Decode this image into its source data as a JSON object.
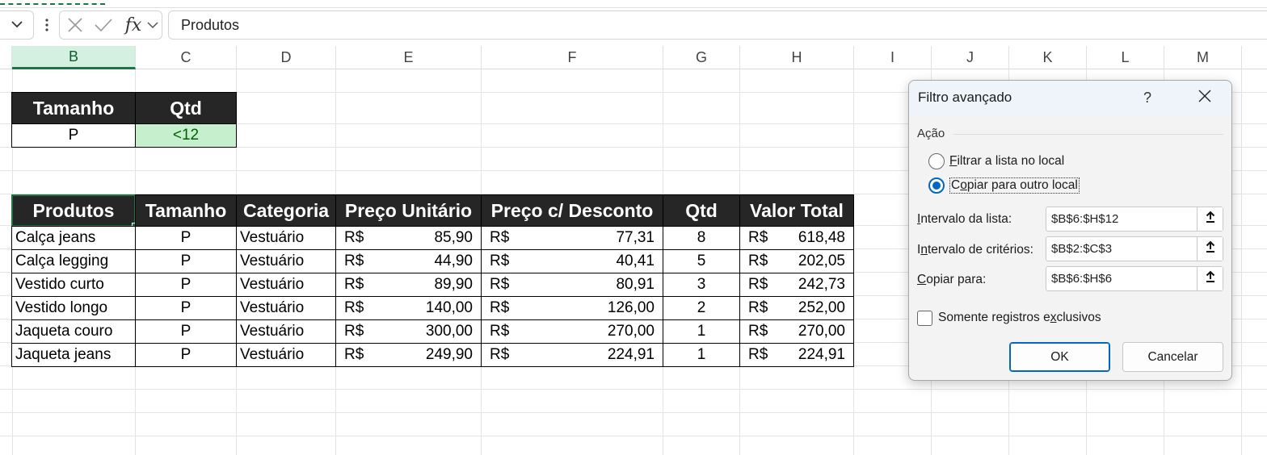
{
  "formula_bar": {
    "value": "Produtos",
    "fx_label": "fx"
  },
  "columns": [
    "B",
    "C",
    "D",
    "E",
    "F",
    "G",
    "H",
    "I",
    "J",
    "K",
    "L",
    "M"
  ],
  "selected_column": "B",
  "criteria": {
    "headers": [
      "Tamanho",
      "Qtd"
    ],
    "values": [
      "P",
      "<12"
    ]
  },
  "table": {
    "headers": [
      "Produtos",
      "Tamanho",
      "Categoria",
      "Preço Unitário",
      "Preço c/ Desconto",
      "Qtd",
      "Valor Total"
    ],
    "rows": [
      {
        "produto": "Calça jeans",
        "tamanho": "P",
        "categoria": "Vestuário",
        "preco_cur": "R$",
        "preco": "85,90",
        "desc_cur": "R$",
        "desconto": "77,31",
        "qtd": "8",
        "total_cur": "R$",
        "total": "618,48"
      },
      {
        "produto": "Calça legging",
        "tamanho": "P",
        "categoria": "Vestuário",
        "preco_cur": "R$",
        "preco": "44,90",
        "desc_cur": "R$",
        "desconto": "40,41",
        "qtd": "5",
        "total_cur": "R$",
        "total": "202,05"
      },
      {
        "produto": "Vestido curto",
        "tamanho": "P",
        "categoria": "Vestuário",
        "preco_cur": "R$",
        "preco": "89,90",
        "desc_cur": "R$",
        "desconto": "80,91",
        "qtd": "3",
        "total_cur": "R$",
        "total": "242,73"
      },
      {
        "produto": "Vestido longo",
        "tamanho": "P",
        "categoria": "Vestuário",
        "preco_cur": "R$",
        "preco": "140,00",
        "desc_cur": "R$",
        "desconto": "126,00",
        "qtd": "2",
        "total_cur": "R$",
        "total": "252,00"
      },
      {
        "produto": "Jaqueta couro",
        "tamanho": "P",
        "categoria": "Vestuário",
        "preco_cur": "R$",
        "preco": "300,00",
        "desc_cur": "R$",
        "desconto": "270,00",
        "qtd": "1",
        "total_cur": "R$",
        "total": "270,00"
      },
      {
        "produto": "Jaqueta jeans",
        "tamanho": "P",
        "categoria": "Vestuário",
        "preco_cur": "R$",
        "preco": "249,90",
        "desc_cur": "R$",
        "desconto": "224,91",
        "qtd": "1",
        "total_cur": "R$",
        "total": "224,91"
      }
    ]
  },
  "dialog": {
    "title": "Filtro avançado",
    "help": "?",
    "group_label": "Ação",
    "radio_filter": {
      "accel": "F",
      "rest": "iltrar a lista no local",
      "selected": false
    },
    "radio_copy": {
      "accel": "o",
      "pre": "C",
      "rest": "piar para outro local",
      "selected": true
    },
    "list_range": {
      "accel": "I",
      "rest": "ntervalo da lista:",
      "value": "$B$6:$H$12"
    },
    "criteria_range": {
      "accel": "n",
      "pre": "I",
      "rest": "tervalo de critérios:",
      "value": "$B$2:$C$3"
    },
    "copy_to": {
      "accel": "C",
      "rest": "opiar para:",
      "value": "$B$6:$H$6"
    },
    "unique": {
      "pre": "Somente registros e",
      "accel": "x",
      "rest": "clusivos",
      "checked": false
    },
    "ok_label": "OK",
    "cancel_label": "Cancelar"
  },
  "colors": {
    "accent": "#217346",
    "header_bg": "#262626",
    "criteria_green_bg": "#c6efce",
    "criteria_green_text": "#006100",
    "dialog_blue": "#0067c0"
  }
}
